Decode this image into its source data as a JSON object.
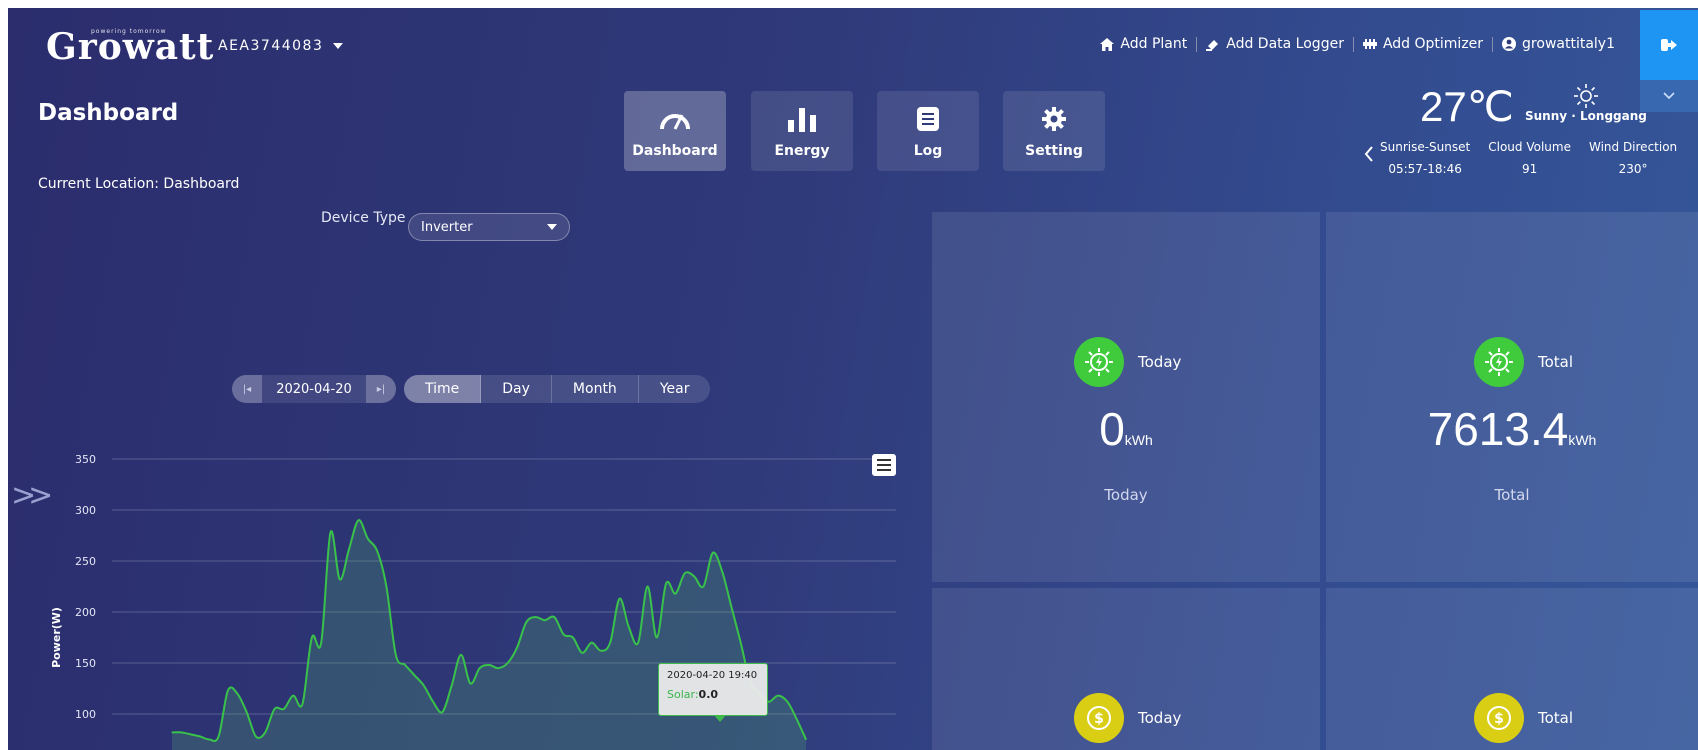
{
  "header": {
    "logo_text": "Growatt",
    "logo_tagline": "powering tomorrow",
    "plant_id": "AEA3744083",
    "links": [
      {
        "label": "Add Plant",
        "icon": "home-icon"
      },
      {
        "label": "Add Data Logger",
        "icon": "logger-icon"
      },
      {
        "label": "Add Optimizer",
        "icon": "optimizer-icon"
      },
      {
        "label": "growattitaly1",
        "icon": "user-icon"
      }
    ]
  },
  "page": {
    "title": "Dashboard",
    "breadcrumb": "Current Location: Dashboard"
  },
  "nav": [
    {
      "label": "Dashboard",
      "icon": "gauge-icon",
      "active": true
    },
    {
      "label": "Energy",
      "icon": "bar-chart-icon",
      "active": false
    },
    {
      "label": "Log",
      "icon": "log-icon",
      "active": false
    },
    {
      "label": "Setting",
      "icon": "gear-icon",
      "active": false
    }
  ],
  "weather": {
    "temperature": "27℃",
    "description": "Sunny · Longgang",
    "icon": "sun-icon",
    "details": [
      {
        "label": "Sunrise-Sunset",
        "value": "05:57-18:46"
      },
      {
        "label": "Cloud Volume",
        "value": "91"
      },
      {
        "label": "Wind Direction",
        "value": "230°"
      }
    ]
  },
  "device": {
    "label": "Device Type",
    "selected": "Inverter"
  },
  "date_nav": {
    "date": "2020-04-20"
  },
  "range_tabs": [
    "Time",
    "Day",
    "Month",
    "Year"
  ],
  "active_range": "Time",
  "tooltip": {
    "time": "2020-04-20 19:40",
    "series": "Solar:",
    "value": "0.0"
  },
  "chart_data": {
    "type": "area",
    "ylabel": "Power(W)",
    "ylim": [
      75,
      350
    ],
    "yticks": [
      100,
      150,
      200,
      250,
      300,
      350
    ],
    "grid": true,
    "series": [
      {
        "name": "Solar",
        "color": "#39c24a",
        "values": [
          82,
          82,
          80,
          78,
          75,
          78,
          123,
          120,
          102,
          78,
          82,
          105,
          105,
          118,
          110,
          175,
          170,
          278,
          232,
          262,
          290,
          272,
          260,
          225,
          158,
          148,
          138,
          128,
          112,
          102,
          128,
          158,
          130,
          145,
          148,
          145,
          150,
          165,
          190,
          195,
          192,
          195,
          178,
          175,
          160,
          170,
          162,
          170,
          213,
          185,
          170,
          225,
          175,
          228,
          218,
          238,
          235,
          225,
          258,
          240,
          205,
          170,
          132,
          120,
          112,
          118,
          112,
          95,
          75
        ]
      }
    ]
  },
  "cards": [
    {
      "badge": "green",
      "icon": "solar-icon",
      "head": "Today",
      "value": "0",
      "unit": "kWh",
      "caption": "Today"
    },
    {
      "badge": "green",
      "icon": "solar-icon",
      "head": "Total",
      "value": "7613.4",
      "unit": "kWh",
      "caption": "Total"
    },
    {
      "badge": "yellow",
      "icon": "dollar-icon",
      "head": "Today"
    },
    {
      "badge": "yellow",
      "icon": "dollar-icon",
      "head": "Total"
    }
  ]
}
